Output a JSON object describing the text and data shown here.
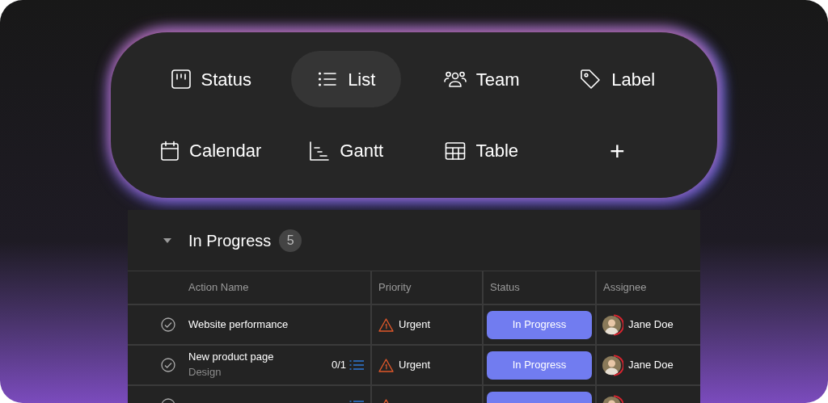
{
  "views": [
    {
      "label": "Status",
      "selected": false
    },
    {
      "label": "List",
      "selected": true
    },
    {
      "label": "Team",
      "selected": false
    },
    {
      "label": "Label",
      "selected": false
    },
    {
      "label": "Calendar",
      "selected": false
    },
    {
      "label": "Gantt",
      "selected": false
    },
    {
      "label": "Table",
      "selected": false
    },
    {
      "label": "+",
      "selected": false
    }
  ],
  "group": {
    "title": "In Progress",
    "count": "5",
    "expanded": true
  },
  "table": {
    "columns": [
      "Action Name",
      "Priority",
      "Status",
      "Assignee"
    ],
    "rows": [
      {
        "name": "Website performance",
        "priority": "Urgent",
        "status": "In Progress",
        "assignee": "Jane Doe"
      },
      {
        "name": "New product page",
        "subtitle": "Design",
        "subtasks": "0/1",
        "priority": "Urgent",
        "status": "In Progress",
        "assignee": "Jane Doe"
      },
      {
        "subtasks_icon": true
      }
    ]
  }
}
